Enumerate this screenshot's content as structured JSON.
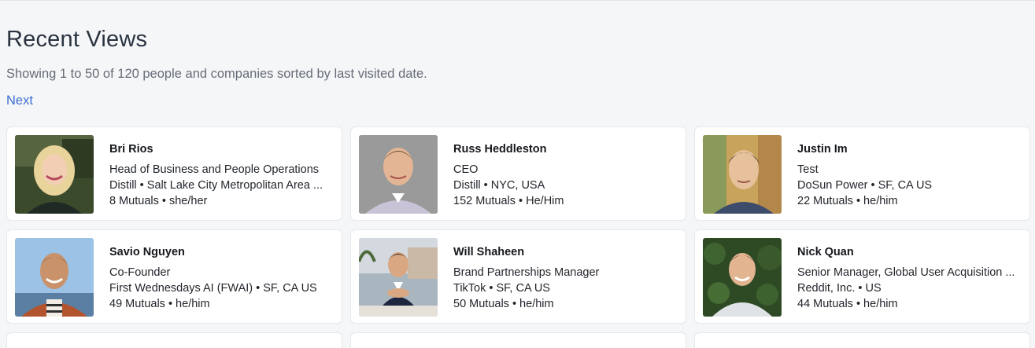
{
  "page": {
    "title": "Recent Views",
    "subtitle": "Showing 1 to 50 of 120 people and companies sorted by last visited date.",
    "next_label": "Next"
  },
  "colors": {
    "link": "#3d6fd2",
    "page_background": "#f5f6f8",
    "card_background": "#ffffff"
  },
  "people": [
    {
      "name": "Bri Rios",
      "title": "Head of Business and People Operations",
      "company_location": "Distill • Salt Lake City Metropolitan Area ...",
      "mutuals_pronouns": "8 Mutuals • she/her",
      "photo": "profile-photo-bri-rios"
    },
    {
      "name": "Russ Heddleston",
      "title": "CEO",
      "company_location": "Distill • NYC, USA",
      "mutuals_pronouns": "152 Mutuals • He/Him",
      "photo": "profile-photo-russ-heddleston"
    },
    {
      "name": "Justin Im",
      "title": "Test",
      "company_location": "DoSun Power • SF, CA US",
      "mutuals_pronouns": "22 Mutuals • he/him",
      "photo": "profile-photo-justin-im"
    },
    {
      "name": "Savio Nguyen",
      "title": "Co-Founder",
      "company_location": "First Wednesdays AI (FWAI) • SF, CA US",
      "mutuals_pronouns": "49 Mutuals • he/him",
      "photo": "profile-photo-savio-nguyen"
    },
    {
      "name": "Will Shaheen",
      "title": "Brand Partnerships Manager",
      "company_location": "TikTok • SF, CA US",
      "mutuals_pronouns": "50 Mutuals • he/him",
      "photo": "profile-photo-will-shaheen"
    },
    {
      "name": "Nick Quan",
      "title": "Senior Manager, Global User Acquisition ...",
      "company_location": "Reddit, Inc. • US",
      "mutuals_pronouns": "44 Mutuals • he/him",
      "photo": "profile-photo-nick-quan"
    }
  ]
}
